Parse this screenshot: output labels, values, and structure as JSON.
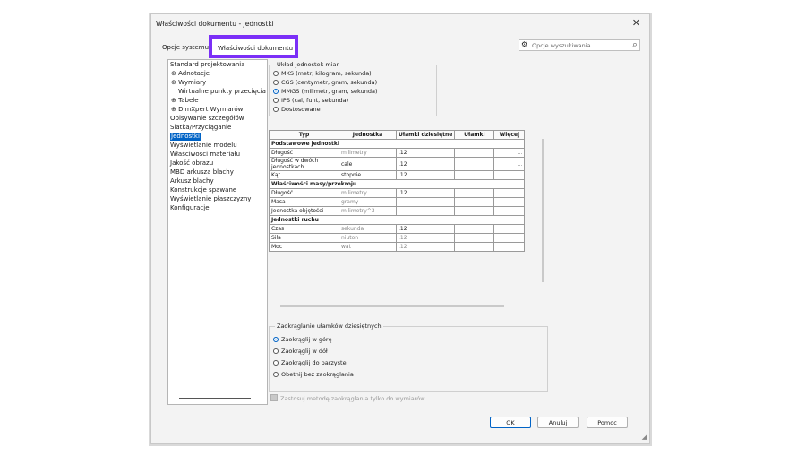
{
  "window": {
    "title": "Właściwości dokumentu - Jednostki"
  },
  "tabs": [
    {
      "label": "Opcje systemu"
    },
    {
      "label": "Właściwości dokumentu"
    }
  ],
  "search": {
    "placeholder": "Opcje wyszukiwania"
  },
  "tree": {
    "items": [
      {
        "label": "Standard projektowania"
      },
      {
        "label": "Adnotacje"
      },
      {
        "label": "Wymiary"
      },
      {
        "label": "Wirtualne punkty przecięcia"
      },
      {
        "label": "Tabele"
      },
      {
        "label": "DimXpert Wymiarów"
      },
      {
        "label": "Opisywanie szczegółów"
      },
      {
        "label": "Siatka/Przyciąganie"
      },
      {
        "label": "Jednostki"
      },
      {
        "label": "Wyświetlanie modelu"
      },
      {
        "label": "Właściwości materiału"
      },
      {
        "label": "Jakość obrazu"
      },
      {
        "label": "MBD arkusza blachy"
      },
      {
        "label": "Arkusz blachy"
      },
      {
        "label": "Konstrukcje spawane"
      },
      {
        "label": "Wyświetlanie płaszczyzny"
      },
      {
        "label": "Konfiguracje"
      }
    ]
  },
  "unit_system": {
    "label": "Układ jednostek miar",
    "options": [
      {
        "label": "MKS  (metr, kilogram, sekunda)",
        "selected": false
      },
      {
        "label": "CGS  (centymetr, gram, sekunda)",
        "selected": false
      },
      {
        "label": "MMGS  (milimetr, gram, sekunda)",
        "selected": true
      },
      {
        "label": "IPS  (cal, funt, sekunda)",
        "selected": false
      },
      {
        "label": "Dostosowane",
        "selected": false
      }
    ]
  },
  "units_table": {
    "headers": [
      "Typ",
      "Jednostka",
      "Ułamki dziesiętne",
      "Ułamki",
      "Więcej"
    ],
    "sections": [
      {
        "title": "Podstawowe jednostki",
        "rows": [
          {
            "type": "Długość",
            "unit": "milimetry",
            "decimals": ".12",
            "fractions": "",
            "more": "..."
          },
          {
            "type": "Długość w dwóch jednostkach",
            "unit": "cale",
            "decimals": ".12",
            "fractions": "",
            "more": "..."
          },
          {
            "type": "Kąt",
            "unit": "stopnie",
            "decimals": ".12",
            "fractions": "",
            "more": ""
          }
        ]
      },
      {
        "title": "Właściwości masy/przekroju",
        "rows": [
          {
            "type": "Długość",
            "unit": "milimetry",
            "decimals": ".12",
            "fractions": "",
            "more": ""
          },
          {
            "type": "Masa",
            "unit": "gramy",
            "decimals": "",
            "fractions": "",
            "more": ""
          },
          {
            "type": "Jednostka objętości",
            "unit": "milimetry^3",
            "decimals": "",
            "fractions": "",
            "more": ""
          }
        ]
      },
      {
        "title": "Jednostki ruchu",
        "rows": [
          {
            "type": "Czas",
            "unit": "sekunda",
            "decimals": ".12",
            "fractions": "",
            "more": ""
          },
          {
            "type": "Siła",
            "unit": "niuton",
            "decimals": ".12",
            "fractions": "",
            "more": ""
          },
          {
            "type": "Moc",
            "unit": "wat",
            "decimals": ".12",
            "fractions": "",
            "more": ""
          }
        ]
      }
    ]
  },
  "rounding": {
    "label": "Zaokrąglanie ułamków dziesiętnych",
    "options": [
      {
        "label": "Zaokrąglij w górę",
        "selected": true
      },
      {
        "label": "Zaokrąglij w dół",
        "selected": false
      },
      {
        "label": "Zaokrąglij do parzystej",
        "selected": false
      },
      {
        "label": "Obetnij bez zaokrąglania",
        "selected": false
      }
    ]
  },
  "apply_checkbox": {
    "label": "Zastosuj metodę zaokrąglania tylko do wymiarów",
    "checked": false,
    "enabled": false
  },
  "buttons": {
    "ok": "OK",
    "cancel": "Anuluj",
    "help": "Pomoc"
  }
}
